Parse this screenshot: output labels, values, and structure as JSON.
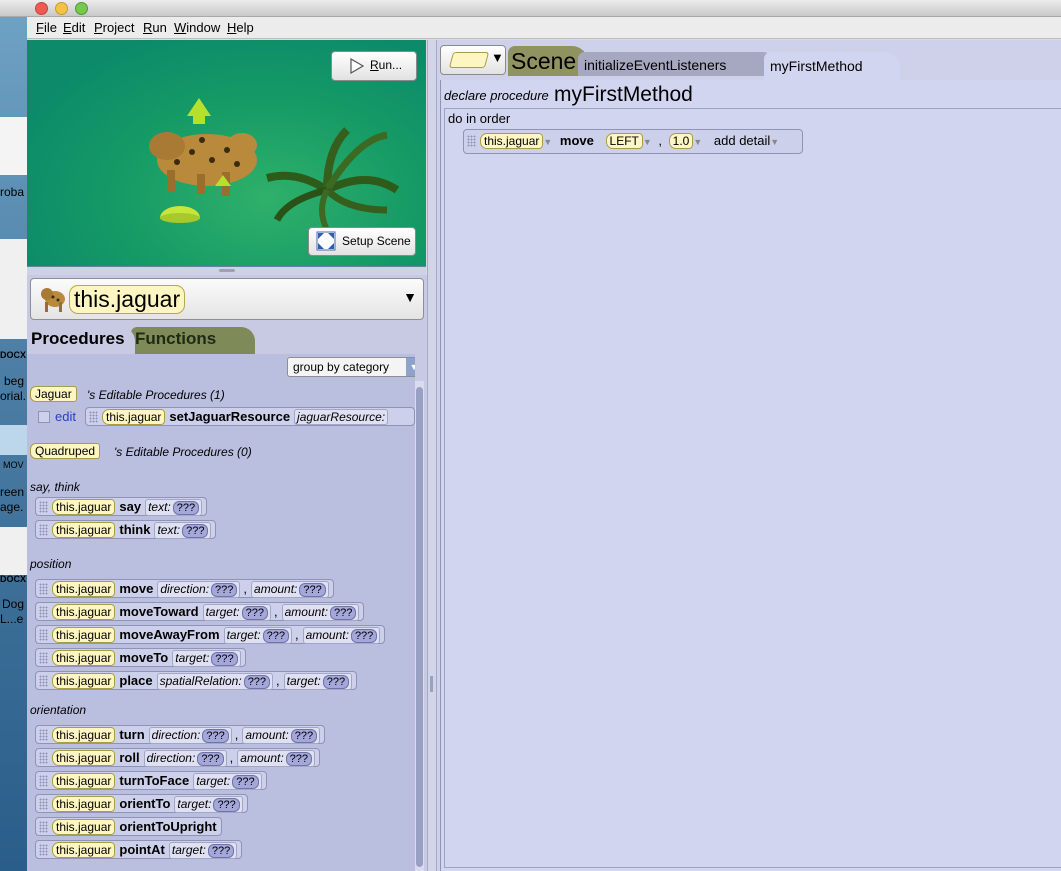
{
  "menubar": {
    "items": [
      {
        "first": "F",
        "rest": "ile"
      },
      {
        "first": "E",
        "rest": "dit"
      },
      {
        "first": "P",
        "rest": "roject"
      },
      {
        "first": "R",
        "rest": "un"
      },
      {
        "first": "W",
        "rest": "indow"
      },
      {
        "first": "H",
        "rest": "elp"
      }
    ]
  },
  "desktop_fragments": [
    "roba",
    "DOCX",
    "beg",
    "orial.",
    "MOV",
    "reen",
    "age.",
    "DOCX",
    "Dog",
    "L...e"
  ],
  "scene": {
    "run_button": {
      "first": "R",
      "rest": "un..."
    },
    "setup_button": "Setup Scene"
  },
  "selector": {
    "value": "this.jaguar"
  },
  "left_tabs": {
    "procedures": "Procedures",
    "functions": "Functions"
  },
  "group_by": "group by category",
  "editable_sections": [
    {
      "class": "Jaguar",
      "label": "'s Editable Procedures (1)"
    },
    {
      "class": "Quadruped",
      "label": "'s Editable Procedures (0)"
    }
  ],
  "edit_link": "edit",
  "set_resource": {
    "object": "this.jaguar",
    "method": "setJaguarResource",
    "param": "jaguarResource:"
  },
  "categories": {
    "say_think": "say, think",
    "position": "position",
    "orientation": "orientation"
  },
  "object_name": "this.jaguar",
  "placeholder": "???",
  "comma": ",",
  "procedures": [
    {
      "method": "say",
      "p1": "text:",
      "p2": ""
    },
    {
      "method": "think",
      "p1": "text:",
      "p2": ""
    },
    {
      "method": "move",
      "p1": "direction:",
      "p2": "amount:"
    },
    {
      "method": "moveToward",
      "p1": "target:",
      "p2": "amount:"
    },
    {
      "method": "moveAwayFrom",
      "p1": "target:",
      "p2": "amount:"
    },
    {
      "method": "moveTo",
      "p1": "target:",
      "p2": ""
    },
    {
      "method": "place",
      "p1": "spatialRelation:",
      "p2": "target:"
    },
    {
      "method": "turn",
      "p1": "direction:",
      "p2": "amount:"
    },
    {
      "method": "roll",
      "p1": "direction:",
      "p2": "amount:"
    },
    {
      "method": "turnToFace",
      "p1": "target:",
      "p2": ""
    },
    {
      "method": "orientTo",
      "p1": "target:",
      "p2": ""
    },
    {
      "method": "orientToUpright",
      "p1": "",
      "p2": ""
    },
    {
      "method": "pointAt",
      "p1": "target:",
      "p2": ""
    }
  ],
  "editor": {
    "tabs": {
      "scene": "Scene",
      "init": "initializeEventListeners",
      "method": "myFirstMethod"
    },
    "declare_label": "declare procedure",
    "method_name": "myFirstMethod",
    "do_in_order": "do in order",
    "statement": {
      "object": "this.jaguar",
      "method": "move",
      "direction": "LEFT",
      "amount": "1.0",
      "detail": "add detail"
    }
  },
  "colors": {
    "block_bg": "#cdd0ea",
    "object_pill": "#fdf6c3",
    "active_tab": "#c8cae3",
    "scene_tab": "#8f9360"
  }
}
